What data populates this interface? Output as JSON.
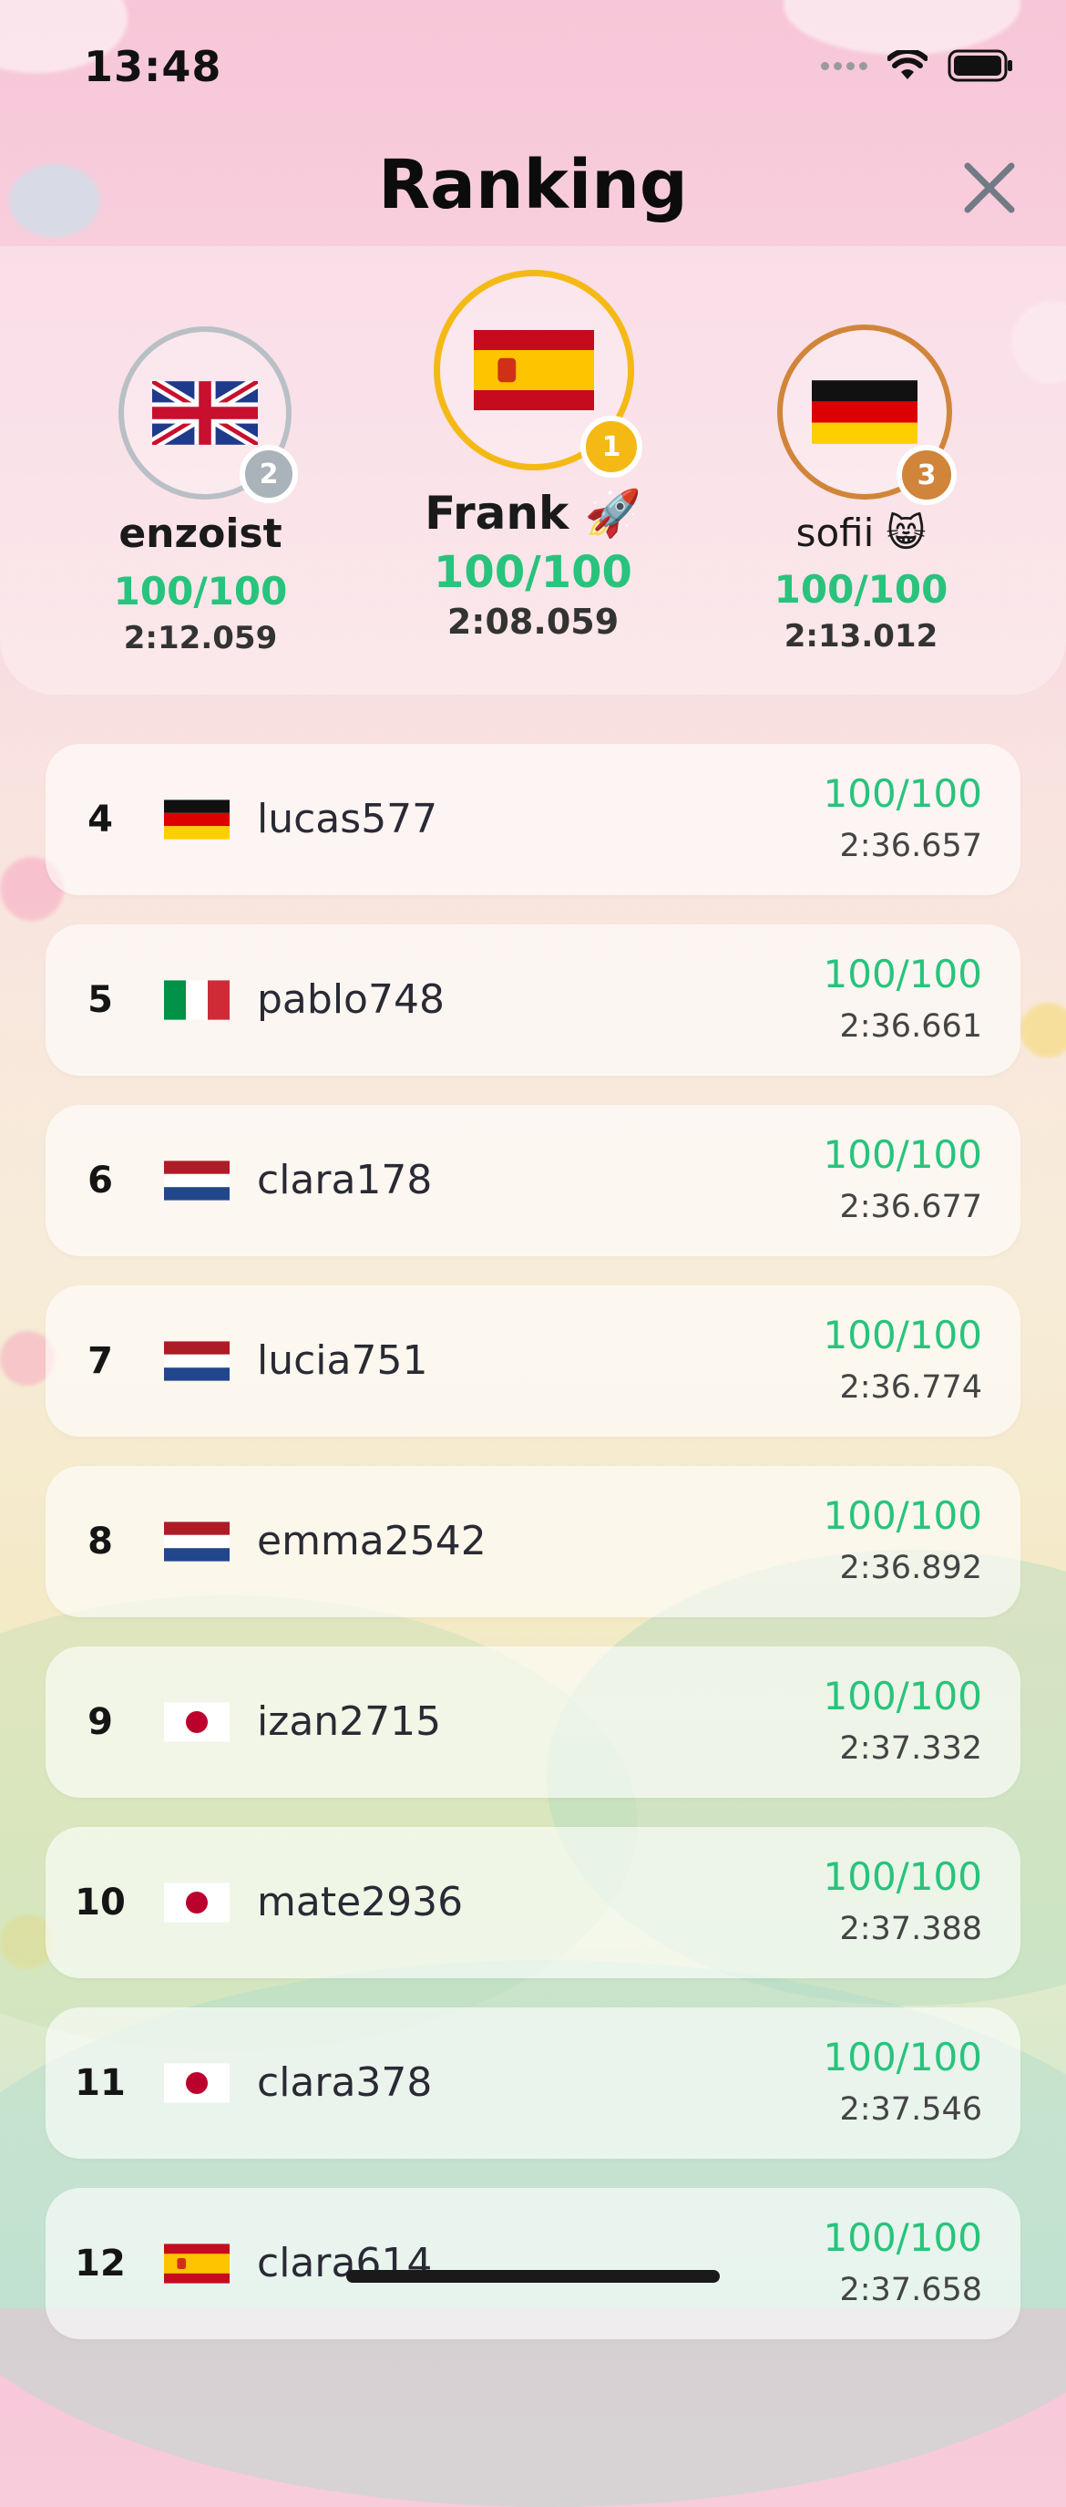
{
  "status_bar": {
    "time": "13:48"
  },
  "header": {
    "title": "Ranking",
    "close_icon": "close-icon"
  },
  "podium": [
    {
      "place": "1",
      "name": "Frank 🚀",
      "score": "100/100",
      "time": "2:08.059",
      "flag": "spain",
      "ring_color": "#f4b915",
      "badge_color": "#f4b915"
    },
    {
      "place": "2",
      "name": "enzoist",
      "score": "100/100",
      "time": "2:12.059",
      "flag": "uk",
      "ring_color": "#b8c0c5",
      "badge_color": "#aab3b9"
    },
    {
      "place": "3",
      "name": "sofii 😸",
      "score": "100/100",
      "time": "2:13.012",
      "flag": "germany",
      "ring_color": "#d0853a",
      "badge_color": "#d0853a"
    }
  ],
  "rows": [
    {
      "rank": "4",
      "flag": "germany",
      "name": "lucas577",
      "score": "100/100",
      "time": "2:36.657"
    },
    {
      "rank": "5",
      "flag": "italy",
      "name": "pablo748",
      "score": "100/100",
      "time": "2:36.661"
    },
    {
      "rank": "6",
      "flag": "netherlands",
      "name": "clara178",
      "score": "100/100",
      "time": "2:36.677"
    },
    {
      "rank": "7",
      "flag": "netherlands",
      "name": "lucia751",
      "score": "100/100",
      "time": "2:36.774"
    },
    {
      "rank": "8",
      "flag": "netherlands",
      "name": "emma2542",
      "score": "100/100",
      "time": "2:36.892"
    },
    {
      "rank": "9",
      "flag": "japan",
      "name": "izan2715",
      "score": "100/100",
      "time": "2:37.332"
    },
    {
      "rank": "10",
      "flag": "japan",
      "name": "mate2936",
      "score": "100/100",
      "time": "2:37.388"
    },
    {
      "rank": "11",
      "flag": "japan",
      "name": "clara378",
      "score": "100/100",
      "time": "2:37.546"
    },
    {
      "rank": "12",
      "flag": "spain",
      "name": "clara614",
      "score": "100/100",
      "time": "2:37.658"
    }
  ],
  "colors": {
    "score_green": "#28c37c",
    "gold": "#f4b915",
    "silver": "#aab3b9",
    "bronze": "#d0853a"
  }
}
